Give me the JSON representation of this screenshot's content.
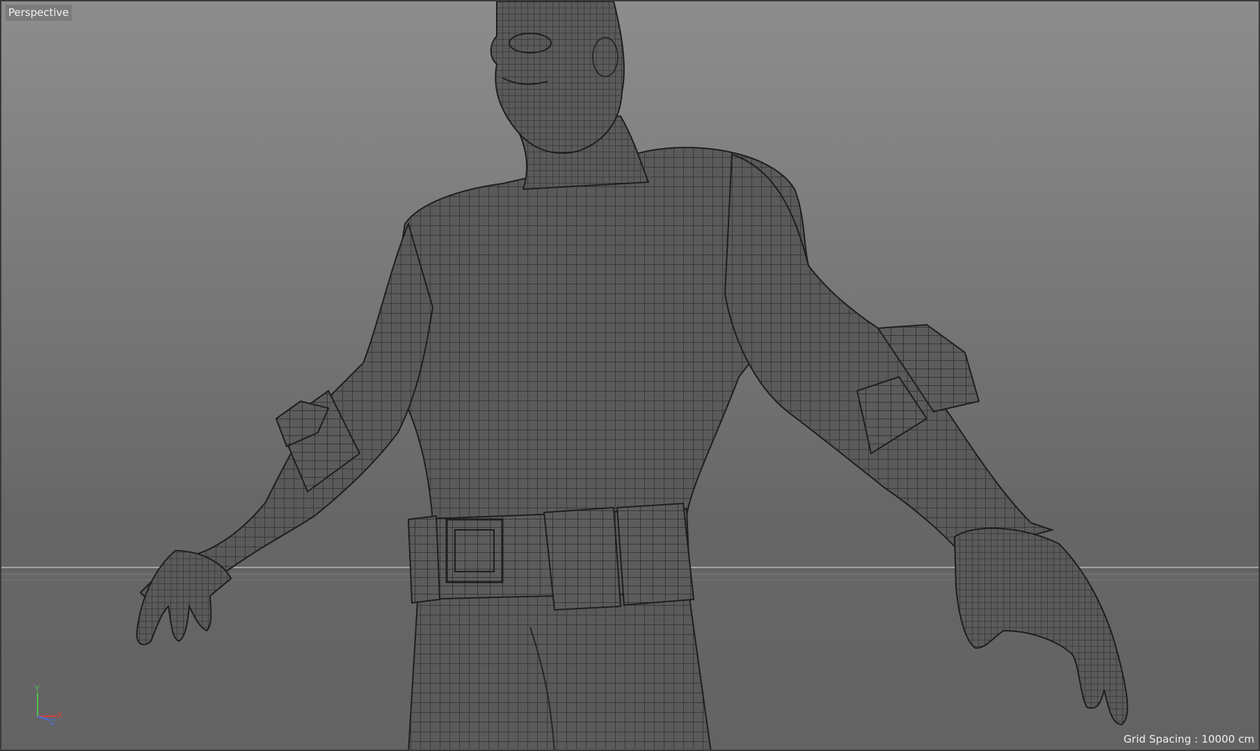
{
  "viewport": {
    "label": "Perspective",
    "grid_spacing_text": "Grid Spacing : 10000 cm",
    "axis_labels": {
      "y": "Y",
      "x": "X",
      "z": "Z"
    },
    "colors": {
      "background_top": "#8d8d8d",
      "background_bottom": "#636363",
      "horizon": "#9a9a9a",
      "mesh_fill": "#5a5a5a",
      "wire": "#262626",
      "axis_x": "#d94040",
      "axis_y": "#4fc24f",
      "axis_z": "#4a6fe0"
    }
  },
  "model": {
    "icon": "wireframe-character-icon"
  }
}
